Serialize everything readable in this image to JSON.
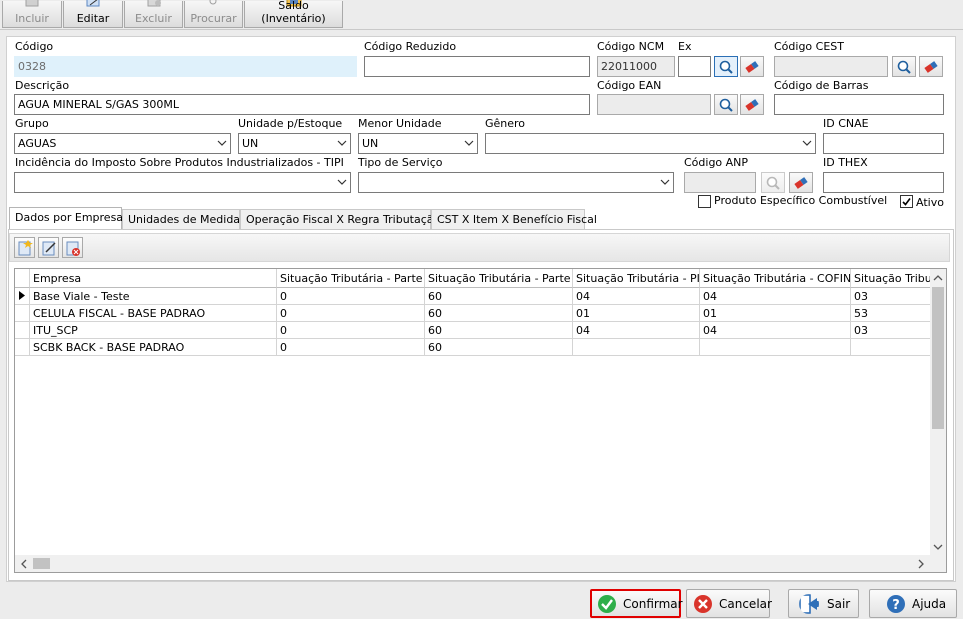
{
  "toolbar": {
    "incluir": "Incluir",
    "editar": "Editar",
    "excluir": "Excluir",
    "procurar": "Procurar",
    "saldo": "Saldo (Inventário)"
  },
  "form": {
    "codigo": {
      "label": "Código",
      "value": "0328"
    },
    "codigo_reduzido": {
      "label": "Código Reduzido",
      "value": ""
    },
    "codigo_ncm": {
      "label": "Código NCM",
      "value": "22011000"
    },
    "ex": {
      "label": "Ex",
      "value": ""
    },
    "codigo_cest": {
      "label": "Código CEST",
      "value": ""
    },
    "descricao": {
      "label": "Descrição",
      "value": "AGUA MINERAL S/GAS 300ML"
    },
    "codigo_ean": {
      "label": "Código EAN",
      "value": ""
    },
    "codigo_barras": {
      "label": "Código de Barras",
      "value": ""
    },
    "grupo": {
      "label": "Grupo",
      "value": "AGUAS"
    },
    "unidade_estoque": {
      "label": "Unidade p/Estoque",
      "value": "UN"
    },
    "menor_unidade": {
      "label": "Menor Unidade",
      "value": "UN"
    },
    "genero": {
      "label": "Gênero",
      "value": ""
    },
    "id_cnae": {
      "label": "ID CNAE",
      "value": ""
    },
    "ipi": {
      "label": "Incidência do Imposto Sobre Produtos Industrializados - TIPI",
      "value": ""
    },
    "tipo_servico": {
      "label": "Tipo de Serviço",
      "value": ""
    },
    "codigo_anp": {
      "label": "Código ANP",
      "value": ""
    },
    "id_thex": {
      "label": "ID THEX",
      "value": ""
    },
    "produto_combustivel": {
      "label": "Produto Específico Combustível",
      "checked": false
    },
    "ativo": {
      "label": "Ativo",
      "checked": true
    }
  },
  "tabs": [
    {
      "label": "Dados por Empresa",
      "active": true
    },
    {
      "label": "Unidades de Medida",
      "active": false
    },
    {
      "label": "Operação Fiscal X Regra Tributação",
      "active": false
    },
    {
      "label": "CST X Item X Benefício Fiscal",
      "active": false
    }
  ],
  "grid": {
    "columns": [
      "Empresa",
      "Situação Tributária - Parte A",
      "Situação Tributária - Parte B",
      "Situação Tributária - PIS",
      "Situação Tributária - COFINS",
      "Situação Tributária"
    ],
    "rows": [
      [
        "Base Viale - Teste",
        "0",
        "60",
        "04",
        "04",
        "03"
      ],
      [
        "CELULA FISCAL - BASE PADRAO",
        "0",
        "60",
        "01",
        "01",
        "53"
      ],
      [
        "ITU_SCP",
        "0",
        "60",
        "04",
        "04",
        "03"
      ],
      [
        "SCBK BACK - BASE PADRAO",
        "0",
        "60",
        "",
        "",
        ""
      ]
    ]
  },
  "buttons": {
    "confirmar": "Confirmar",
    "cancelar": "Cancelar",
    "sair": "Sair",
    "ajuda": "Ajuda"
  },
  "colors": {
    "confirm_outline": "#e00000",
    "confirm_icon": "#2eae4a",
    "cancel_icon": "#d9342b",
    "exit_icon": "#2f6fb8",
    "help_icon": "#2f6fb8",
    "highlight_field": "#dff1fb"
  }
}
